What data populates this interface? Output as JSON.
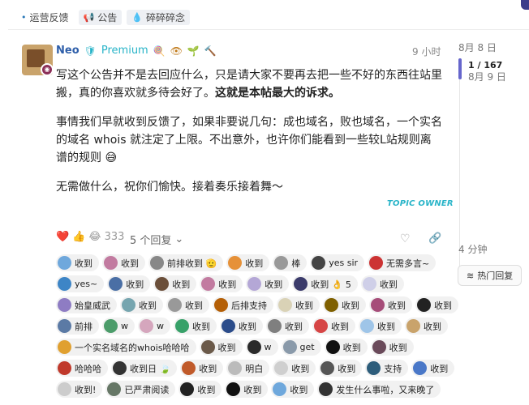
{
  "categories": [
    {
      "label": "运营反馈",
      "icon": "dot-icon"
    },
    {
      "label": "公告",
      "icon": "megaphone-icon"
    },
    {
      "label": "碎碎碎念",
      "icon": "drop-icon"
    }
  ],
  "post": {
    "author": "Neo",
    "title": "Premium",
    "time": "9 小时",
    "paragraphs": [
      {
        "text": "写这个公告并不是去回应什么，只是请大家不要再去把一些不好的东西往站里搬，真的你喜欢就多待会好了。",
        "bold": "这就是本帖最大的诉求。"
      },
      {
        "text": "事情我们早就收到反馈了，如果非要说几句：成也域名，败也域名，一个实名的域名 whois 就注定了上限。不出意外，也许你们能看到一些较L站规则离谱的规则 😅",
        "bold": ""
      },
      {
        "text": "无需做什么，祝你们愉快。接着奏乐接着舞〜",
        "bold": ""
      }
    ],
    "owner_label": "TOPIC OWNER",
    "reaction_count": "333",
    "replies_label": "5 个回复"
  },
  "timeline": {
    "start_date": "8月 8 日",
    "position": "1 / 167",
    "current_date": "8月 9 日",
    "ago": "4 分钟",
    "hot_label": "热门回复"
  },
  "replies": [
    {
      "text": "收到",
      "color": "#6fa8dc"
    },
    {
      "text": "收到",
      "color": "#c27ba0"
    },
    {
      "text": "前排收到 🫡",
      "color": "#888888"
    },
    {
      "text": "收到",
      "color": "#e69138"
    },
    {
      "text": "棒",
      "color": "#999999"
    },
    {
      "text": "yes sir",
      "color": "#444444"
    },
    {
      "text": "无需多言~",
      "color": "#cc3333"
    },
    {
      "text": "yes~",
      "color": "#3d85c6"
    },
    {
      "text": "收到",
      "color": "#4a6fa5"
    },
    {
      "text": "收到",
      "color": "#6b4f3a"
    },
    {
      "text": "收到",
      "color": "#c27ba0"
    },
    {
      "text": "收到",
      "color": "#b4a7d6"
    },
    {
      "text": "收到 👌 5",
      "color": "#3b3b6b"
    },
    {
      "text": "收到",
      "color": "#cfcfe8"
    },
    {
      "text": "始皇威武",
      "color": "#8e7cc3"
    },
    {
      "text": "收到",
      "color": "#76a5af"
    },
    {
      "text": "收到",
      "color": "#999999"
    },
    {
      "text": "后排支持",
      "color": "#b45f06"
    },
    {
      "text": "收到",
      "color": "#d9d2b6"
    },
    {
      "text": "收到",
      "color": "#7f6000"
    },
    {
      "text": "收到",
      "color": "#a64d79"
    },
    {
      "text": "收到",
      "color": "#222222"
    },
    {
      "text": "前排",
      "color": "#5b7aa5"
    },
    {
      "text": "w",
      "color": "#4c9c6a"
    },
    {
      "text": "w",
      "color": "#d5a6bd"
    },
    {
      "text": "收到",
      "color": "#38a169"
    },
    {
      "text": "收到",
      "color": "#2b4c8a"
    },
    {
      "text": "收到",
      "color": "#7f7f7f"
    },
    {
      "text": "收到",
      "color": "#d64545"
    },
    {
      "text": "收到",
      "color": "#9fc5e8"
    },
    {
      "text": "收到",
      "color": "#c9a36b"
    },
    {
      "text": "一个实名域名的whois哈哈哈",
      "color": "#e0a030"
    },
    {
      "text": "收到",
      "color": "#6b5a4a"
    },
    {
      "text": "w",
      "color": "#2a2a2a"
    },
    {
      "text": "get",
      "color": "#8a9aaa"
    },
    {
      "text": "收到",
      "color": "#111111"
    },
    {
      "text": "收到",
      "color": "#6a4a5a"
    },
    {
      "text": "哈哈哈",
      "color": "#c0392b"
    },
    {
      "text": "收到日 🍃",
      "color": "#333333"
    },
    {
      "text": "收到",
      "color": "#c05a2a"
    },
    {
      "text": "明白",
      "color": "#bbbbbb"
    },
    {
      "text": "收到",
      "color": "#cfcfcf"
    },
    {
      "text": "收到",
      "color": "#555555"
    },
    {
      "text": "支持",
      "color": "#2d5d7b"
    },
    {
      "text": "收到",
      "color": "#4a78c8"
    },
    {
      "text": "收到!",
      "color": "#cccccc"
    },
    {
      "text": "已严肃阅读",
      "color": "#667766"
    },
    {
      "text": "收到",
      "color": "#222222"
    },
    {
      "text": "收到",
      "color": "#111111"
    },
    {
      "text": "收到",
      "color": "#6fa8dc"
    },
    {
      "text": "发生什么事啦，又来晚了",
      "color": "#333333"
    }
  ]
}
